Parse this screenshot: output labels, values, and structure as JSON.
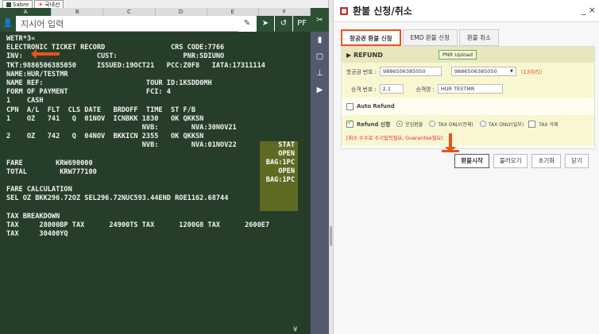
{
  "tabs": [
    {
      "label": "Sabre"
    },
    {
      "label": "국내선"
    }
  ],
  "columns": [
    "A",
    "B",
    "C",
    "D",
    "E",
    "F"
  ],
  "input": {
    "placeholder": "지시어 입력",
    "pf_label": "PF"
  },
  "terminal": {
    "lines": [
      "WETR*3«",
      "ELECTRONIC TICKET RECORD                CRS CODE:7766",
      "INV:                  CUST:                PNR:SDIUNO",
      "TKT:9886506385050     ISSUED:19OCT21   PCC:Z0F8   IATA:17311114",
      "NAME:HUR/TESTMR",
      "NAME REF:                         TOUR ID:1KSDD0MH",
      "FORM OF PAYMENT                   FCI: 4",
      "1    CASH",
      "CPN  A/L  FLT  CLS DATE   BRDOFF  TIME  ST F/B",
      "1    OZ   741   Q  01NOV  ICNBKK 1830   OK QKKSN",
      "                                 NVB:        NVA:30NOV21",
      "2    OZ   742   Q  04NOV  BKKICN 2355   OK QKKSN",
      "                                 NVB:        NVA:01NOV22",
      "",
      "FARE        KRW690000",
      "TOTAL        KRW777100",
      "",
      "FARE CALCULATION",
      "SEL OZ BKK296.72OZ SEL296.72NUC593.44END ROE1162.68744",
      "",
      "TAX BREAKDOWN",
      "TAX     28000BP TAX      24900TS TAX      1200G8 TAX      2600E7",
      "TAX     30400YQ"
    ],
    "stat_col": [
      "STAT",
      "OPEN",
      "BAG:1PC",
      "OPEN",
      "BAG:1PC"
    ],
    "yen": "¥"
  },
  "panel": {
    "title": "환불 신청/취소",
    "close": "_ ×",
    "tabs": [
      "항공권 환불 신청",
      "EMD 환불 신청",
      "환불 취소"
    ],
    "refund_header": "▶ REFUND",
    "pnr_upload": "PNR Upload",
    "ticket_label": "항공권 번호 :",
    "ticket_value": "9886506385050",
    "ticket_select": "9886506385050",
    "ticket_count": "(13자리)",
    "passenger_no_label": "승객 번호 :",
    "passenger_no_value": "2.1",
    "passenger_name_label": "승객명 :",
    "passenger_name_value": "HUR TESTMR",
    "auto_refund": "Auto Refund",
    "refund_apply": "Refund 신청",
    "opt1": "운임환불",
    "opt2": "TAX ONLY(전체)",
    "opt3": "TAX ONLY(일부)",
    "opt4": "TAX 삭제",
    "note": "[취소 수수료 수기입력필요, Guarantee필요]",
    "buttons": [
      "환불시작",
      "불러오기",
      "초기화",
      "닫기"
    ]
  },
  "colors": {
    "terminal_bg": "#263e29",
    "accent": "#e8541c",
    "stat_bg": "#5f6a23"
  }
}
